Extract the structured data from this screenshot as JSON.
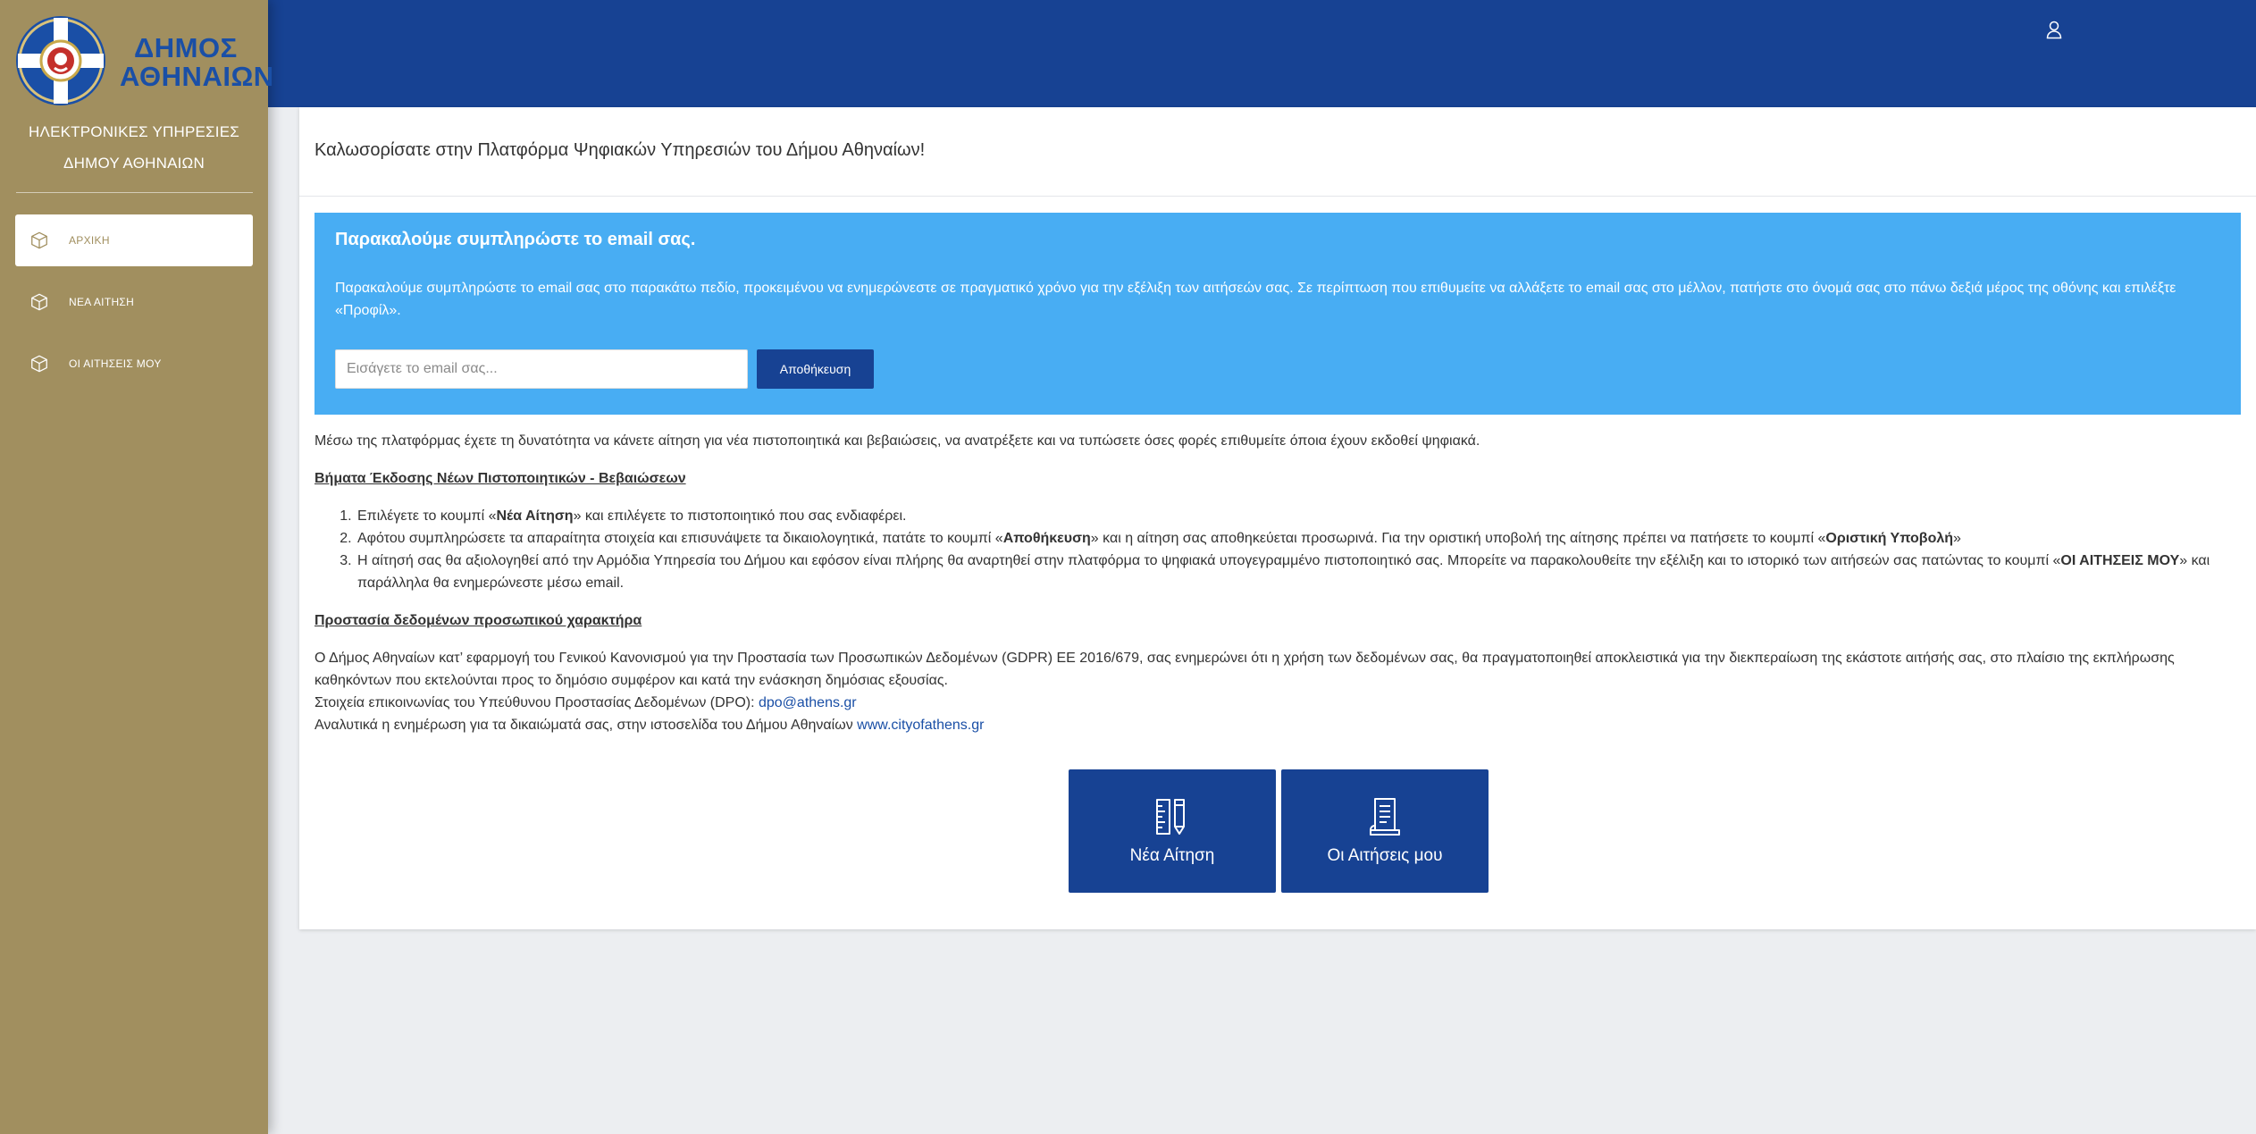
{
  "sidebar": {
    "logo_text_line1": "ΔΗΜΟΣ",
    "logo_text_line2": "ΑΘΗΝΑΙΩΝ",
    "title": "ΗΛΕΚΤΡΟΝΙΚΕΣ ΥΠΗΡΕΣΙΕΣ ΔΗΜΟΥ ΑΘΗΝΑΙΩΝ",
    "items": [
      {
        "label": "ΑΡΧΙΚΗ",
        "icon": "cube-icon",
        "active": true
      },
      {
        "label": "ΝΕΑ ΑΙΤΗΣΗ",
        "icon": "cube-icon",
        "active": false
      },
      {
        "label": "ΟΙ ΑΙΤΗΣΕΙΣ ΜΟΥ",
        "icon": "cube-icon",
        "active": false
      }
    ]
  },
  "header": {
    "user_icon": "user-icon"
  },
  "card": {
    "title": "Καλωσορίσατε στην Πλατφόρμα Ψηφιακών Υπηρεσιών του Δήμου Αθηναίων!"
  },
  "alert": {
    "heading": "Παρακαλούμε συμπληρώστε το email σας.",
    "text": "Παρακαλούμε συμπληρώστε το email σας στο παρακάτω πεδίο, προκειμένου να ενημερώνεστε σε πραγματικό χρόνο για την εξέλιξη των αιτήσεών σας. Σε περίπτωση που επιθυμείτε να αλλάξετε το email σας στο μέλλον, πατήστε στο όνομά σας στο πάνω δεξιά μέρος της οθόνης και επιλέξτε «Προφίλ».",
    "email_placeholder": "Εισάγετε το email σας...",
    "email_value": "",
    "save_label": "Αποθήκευση"
  },
  "content": {
    "intro": "Μέσω της πλατφόρμας έχετε τη δυνατότητα να κάνετε αίτηση για νέα πιστοποιητικά και βεβαιώσεις, να ανατρέξετε και να τυπώσετε όσες φορές επιθυμείτε όποια έχουν εκδοθεί ψηφιακά.",
    "steps_title": "Βήματα Έκδοσης Νέων Πιστοποιητικών - Βεβαιώσεων",
    "step1": {
      "a": "Επιλέγετε το κουμπί «",
      "b": "Νέα Αίτηση",
      "c": "» και επιλέγετε το πιστοποιητικό που σας ενδιαφέρει."
    },
    "step2": {
      "a": "Αφότου συμπληρώσετε τα απαραίτητα στοιχεία και επισυνάψετε τα δικαιολογητικά, πατάτε το κουμπί «",
      "b": "Αποθήκευση",
      "c": "» και η αίτηση σας αποθηκεύεται προσωρινά. Για την οριστική υποβολή της αίτησης πρέπει να πατήσετε το κουμπί «",
      "d": "Οριστική Υποβολή",
      "e": "»"
    },
    "step3": {
      "a": "Η αίτησή σας θα αξιολογηθεί από την Αρμόδια Υπηρεσία του Δήμου και εφόσον είναι πλήρης θα αναρτηθεί στην πλατφόρμα το ψηφιακά υπογεγραμμένο πιστοποιητικό σας. Μπορείτε να παρακολουθείτε την εξέλιξη και το ιστορικό των αιτήσεών σας πατώντας το κουμπί «",
      "b": "ΟΙ ΑΙΤΗΣΕΙΣ ΜΟΥ",
      "c": "» και παράλληλα θα ενημερώνεστε μέσω email."
    },
    "privacy_title": "Προστασία δεδομένων προσωπικού χαρακτήρα",
    "privacy_text": "Ο Δήμος Αθηναίων κατ’ εφαρμογή του Γενικού Κανονισμού για την Προστασία των Προσωπικών Δεδομένων (GDPR) ΕΕ 2016/679, σας ενημερώνει ότι η χρήση των δεδομένων σας, θα πραγματοποιηθεί αποκλειστικά για την διεκπεραίωση της εκάστοτε αιτήσής σας, στο πλαίσιο της εκπλήρωσης καθηκόντων που εκτελούνται προς το δημόσιο συμφέρον και κατά την ενάσκηση δημόσιας εξουσίας.",
    "dpo_label": "Στοιχεία επικοινωνίας του Υπεύθυνου Προστασίας Δεδομένων (DPO): ",
    "dpo_email": "dpo@athens.gr",
    "rights_label": "Αναλυτικά η ενημέρωση για τα δικαιώματά σας, στην ιστοσελίδα του Δήμου Αθηναίων ",
    "rights_link": "www.cityofathens.gr"
  },
  "tiles": [
    {
      "label": "Νέα Αίτηση",
      "icon": "ruler-pencil-icon"
    },
    {
      "label": "Οι Αιτήσεις μου",
      "icon": "document-icon"
    }
  ],
  "colors": {
    "sidebar": "#a18f5f",
    "topbar": "#174293",
    "alert": "#48adf3",
    "primary_button": "#174293"
  }
}
